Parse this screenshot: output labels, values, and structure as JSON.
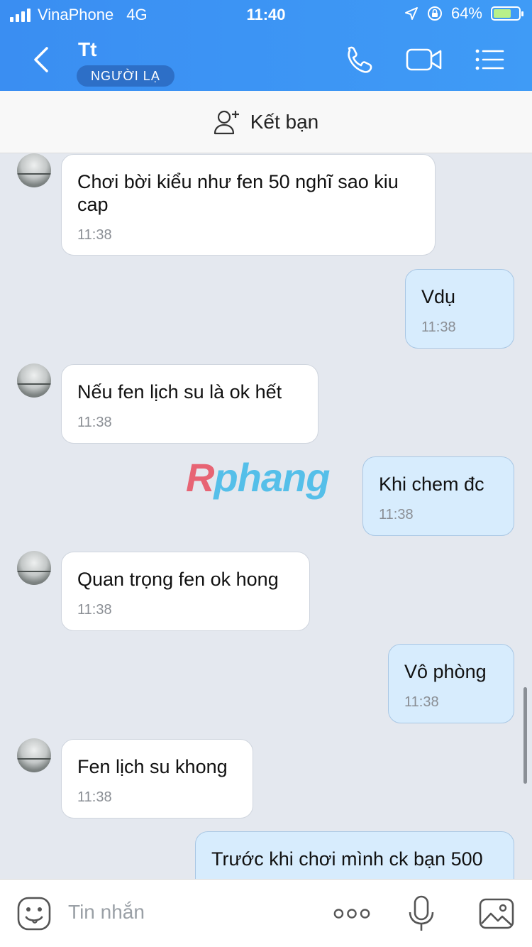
{
  "status_bar": {
    "carrier": "VinaPhone",
    "network": "4G",
    "time": "11:40",
    "battery": "64%"
  },
  "header": {
    "contact_name": "Tt",
    "badge": "NGƯỜI LẠ"
  },
  "friend_bar": {
    "label": "Kết bạn"
  },
  "messages": [
    {
      "direction": "in",
      "text": "Chơi bời kiểu như fen 50 nghĩ sao kiu cap",
      "time": "11:38"
    },
    {
      "direction": "out",
      "text": "Vdụ",
      "time": "11:38"
    },
    {
      "direction": "in",
      "text": "Nếu fen lịch su là ok hết",
      "time": "11:38"
    },
    {
      "direction": "out",
      "text": "Khi chem đc",
      "time": "11:38"
    },
    {
      "direction": "in",
      "text": "Quan trọng fen ok hong",
      "time": "11:38"
    },
    {
      "direction": "out",
      "text": "Vô phòng",
      "time": "11:38"
    },
    {
      "direction": "in",
      "text": "Fen lịch su khong",
      "time": "11:38"
    },
    {
      "direction": "out",
      "text": "Trước khi chơi mình ck bạn 500",
      "time": ""
    }
  ],
  "watermark": {
    "first": "R",
    "rest": "phang"
  },
  "input_bar": {
    "placeholder": "Tin nhắn"
  },
  "icons": [
    "back-arrow-icon",
    "phone-icon",
    "video-camera-icon",
    "menu-list-icon",
    "add-user-icon",
    "emoji-icon",
    "more-dots-icon",
    "microphone-icon",
    "image-icon"
  ]
}
